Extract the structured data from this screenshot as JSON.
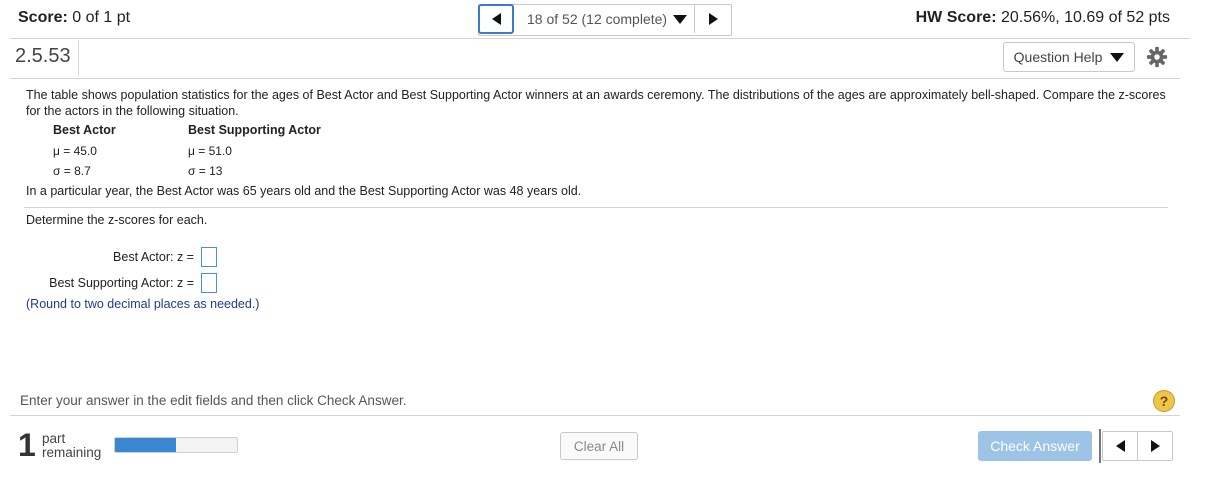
{
  "header": {
    "score_label": "Score:",
    "score_value": "0 of 1 pt",
    "nav_label": "18 of 52 (12 complete)",
    "hw_label": "HW Score:",
    "hw_value": "20.56%, 10.69 of 52 pts"
  },
  "question": {
    "number": "2.5.53",
    "help_label": "Question Help",
    "intro": "The table shows population statistics for the ages of Best Actor and Best Supporting Actor winners at an awards ceremony. The distributions of the ages are approximately bell-shaped. Compare the z-scores for the actors in the following situation.",
    "table": {
      "col1_header": "Best Actor",
      "col2_header": "Best Supporting Actor",
      "col1_mu": "μ = 45.0",
      "col1_sigma": "σ = 8.7",
      "col2_mu": "μ = 51.0",
      "col2_sigma": "σ = 13"
    },
    "situation": "In a particular year, the Best Actor was 65 years old and the Best Supporting Actor was 48 years old.",
    "determine": "Determine the z-scores for each.",
    "answer1_label": "Best Actor:  z  =",
    "answer1_value": "",
    "answer2_label": "Best Supporting Actor:  z  =",
    "answer2_value": "",
    "round_note": "(Round to two decimal places as needed.)"
  },
  "footer": {
    "instruction": "Enter your answer in the edit fields and then click Check Answer.",
    "help_icon": "?",
    "parts_number": "1",
    "parts_text_line1": "part",
    "parts_text_line2": "remaining",
    "progress_fraction": 0.5,
    "clear_label": "Clear All",
    "check_label": "Check Answer"
  },
  "colors": {
    "accent": "#3a7ad0",
    "progress": "#3b86d0",
    "check_button": "#9dc4e6",
    "round_note": "#1f3d8a"
  }
}
